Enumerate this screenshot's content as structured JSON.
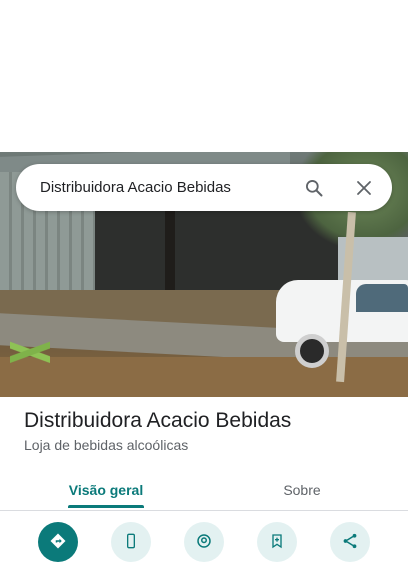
{
  "search": {
    "query": "Distribuidora Acacio Bebidas"
  },
  "place": {
    "name": "Distribuidora Acacio Bebidas",
    "category": "Loja de bebidas alcoólicas"
  },
  "tabs": [
    {
      "label": "Visão geral",
      "active": true
    },
    {
      "label": "Sobre",
      "active": false
    }
  ],
  "actions": [
    {
      "icon": "directions-icon"
    },
    {
      "icon": "phone-icon"
    },
    {
      "icon": "nearby-icon"
    },
    {
      "icon": "save-icon"
    },
    {
      "icon": "share-icon"
    }
  ],
  "colors": {
    "accent": "#0b7a7a",
    "action_bg": "#e3f1f1"
  }
}
